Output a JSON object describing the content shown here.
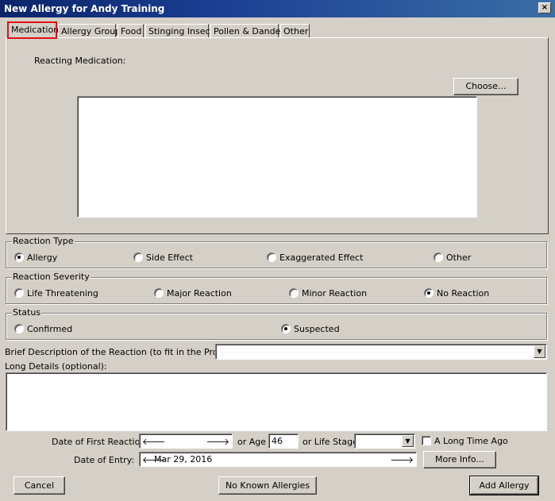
{
  "window": {
    "title": "New Allergy for Andy Training",
    "close_glyph": "×"
  },
  "tabs": [
    "Medication",
    "Allergy Group",
    "Food",
    "Stinging Insect",
    "Pollen & Dander",
    "Other"
  ],
  "medication": {
    "reacting_label": "Reacting Medication:",
    "choose_label": "Choose..."
  },
  "reaction_type": {
    "title": "Reaction Type",
    "options": [
      "Allergy",
      "Side Effect",
      "Exaggerated Effect",
      "Other"
    ],
    "selected": "Allergy"
  },
  "reaction_severity": {
    "title": "Reaction Severity",
    "options": [
      "Life Threatening",
      "Major Reaction",
      "Minor Reaction",
      "No Reaction"
    ],
    "selected": "No Reaction"
  },
  "status": {
    "title": "Status",
    "options": [
      "Confirmed",
      "Suspected"
    ],
    "selected": "Suspected"
  },
  "brief_description": {
    "label": "Brief Description of the Reaction (to fit in the Profile):",
    "value": ""
  },
  "long_details": {
    "label": "Long Details (optional):",
    "value": ""
  },
  "dates": {
    "first_reaction_label": "Date of First Reaction:",
    "first_reaction_value": "",
    "or_age_label": "or Age",
    "age_value": "46",
    "or_life_stage_label": "or Life Stage",
    "life_stage_value": "",
    "long_time_ago_label": "A Long Time Ago",
    "long_time_ago_checked": false,
    "entry_label": "Date of Entry:",
    "entry_value": "Mar 29, 2016",
    "more_info_label": "More Info..."
  },
  "footer": {
    "cancel_label": "Cancel",
    "nka_label": "No Known Allergies",
    "add_label": "Add Allergy"
  },
  "icons": {
    "arrow_left": "🡐",
    "arrow_right": "🡒",
    "dropdown": "▼"
  },
  "colors": {
    "titlebar": "#0a246a",
    "dialog_bg": "#d4d0c8",
    "tab_highlight": "#e01010"
  }
}
